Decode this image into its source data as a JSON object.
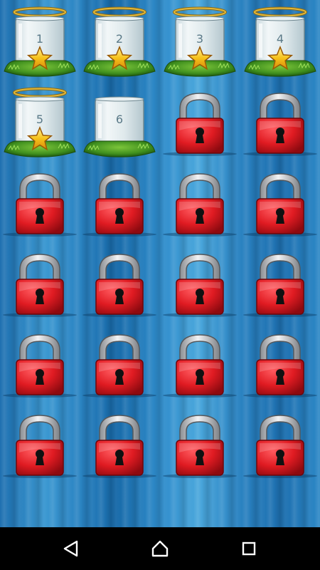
{
  "levels": {
    "row1": [
      {
        "state": "completed",
        "number": "1",
        "stars": 1
      },
      {
        "state": "completed",
        "number": "2",
        "stars": 1
      },
      {
        "state": "completed",
        "number": "3",
        "stars": 1
      },
      {
        "state": "completed",
        "number": "4",
        "stars": 1
      }
    ],
    "row2": [
      {
        "state": "completed",
        "number": "5",
        "stars": 1
      },
      {
        "state": "unlocked",
        "number": "6",
        "stars": 0
      },
      {
        "state": "locked"
      },
      {
        "state": "locked"
      }
    ],
    "row3": [
      {
        "state": "locked"
      },
      {
        "state": "locked"
      },
      {
        "state": "locked"
      },
      {
        "state": "locked"
      }
    ],
    "row4": [
      {
        "state": "locked"
      },
      {
        "state": "locked"
      },
      {
        "state": "locked"
      },
      {
        "state": "locked"
      }
    ],
    "row5": [
      {
        "state": "locked"
      },
      {
        "state": "locked"
      },
      {
        "state": "locked"
      },
      {
        "state": "locked"
      }
    ],
    "row6": [
      {
        "state": "locked"
      },
      {
        "state": "locked"
      },
      {
        "state": "locked"
      },
      {
        "state": "locked"
      }
    ]
  },
  "icons": {
    "jar": "jar-icon",
    "halo": "halo-icon",
    "star": "star-icon",
    "lock": "padlock-icon",
    "back": "back-triangle-icon",
    "home": "home-circle-icon",
    "recents": "recents-square-icon"
  },
  "colors": {
    "background": "#2a83c2",
    "lock_red": "#e01b22",
    "grass": "#3f8f1e",
    "star": "#f6c21a",
    "halo": "#e2b93b",
    "nav_bar": "#000000"
  }
}
